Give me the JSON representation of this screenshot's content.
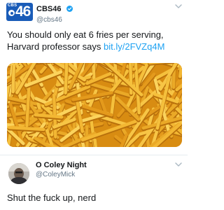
{
  "tweet": {
    "author": {
      "avatar_label": "CBS46",
      "avatar_brand_small": "CBS",
      "avatar_number": "46",
      "avatar_color": "#1a5cb8",
      "display_name": "CBS46",
      "handle": "@cbs46",
      "verified": true,
      "verified_color": "#1da1f2"
    },
    "text": "You should only eat 6 fries per serving, Harvard professor says ",
    "link": "bit.ly/2FVZq4M",
    "link_color": "#1da1f2",
    "media_icon": "french-fries-photo",
    "menu_icon": "chevron-down-icon"
  },
  "reply": {
    "author": {
      "display_name": "O Coley Night",
      "handle": "@ColeyMick"
    },
    "text": "Shut the fuck up, nerd",
    "menu_icon": "chevron-down-icon"
  }
}
